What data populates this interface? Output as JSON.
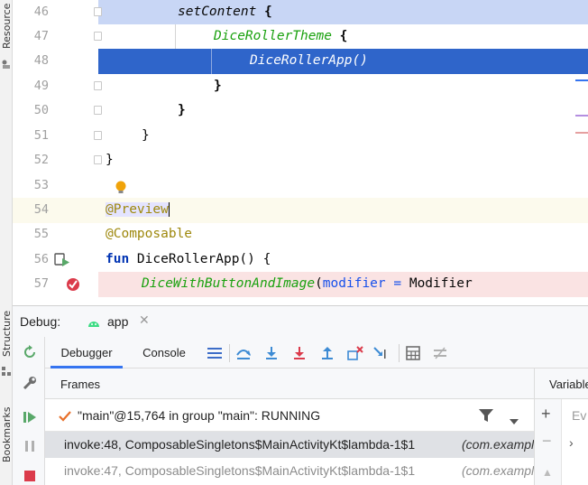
{
  "left_strip": {
    "resource_label": "Resource",
    "structure_label": "Structure",
    "bookmarks_label": "Bookmarks"
  },
  "editor": {
    "lines": [
      {
        "num": "46"
      },
      {
        "num": "47"
      },
      {
        "num": "48"
      },
      {
        "num": "49"
      },
      {
        "num": "50"
      },
      {
        "num": "51"
      },
      {
        "num": "52"
      },
      {
        "num": "53"
      },
      {
        "num": "54"
      },
      {
        "num": "55"
      },
      {
        "num": "56"
      },
      {
        "num": "57"
      }
    ],
    "code": {
      "l46": "setContent",
      "l46_brace": " {",
      "l47": "DiceRollerTheme",
      "l47_brace": " {",
      "l48": "DiceRollerApp()",
      "l49": "}",
      "l50": "}",
      "l51": "}",
      "l52": "}",
      "l54": "@Preview",
      "l55": "@Composable",
      "l56_kw": "fun",
      "l56_rest": " DiceRollerApp() {",
      "l57_fn": "DiceWithButtonAndImage",
      "l57_paren": "(",
      "l57_param": "modifier",
      "l57_eq": " = ",
      "l57_val": "Modifier"
    }
  },
  "debug": {
    "title": "Debug:",
    "session_tab": "app",
    "tabs": [
      "Debugger",
      "Console"
    ],
    "frames_label": "Frames",
    "variables_label": "Variable",
    "thread": "\"main\"@15,764 in group \"main\": RUNNING",
    "frames": [
      {
        "text": "invoke:48, ComposableSingletons$MainActivityKt$lambda-1$1",
        "pkg": "(com.example"
      },
      {
        "text": "invoke:47, ComposableSingletons$MainActivityKt$lambda-1$1",
        "pkg": "(com.example"
      }
    ],
    "eval_placeholder": "Ev"
  },
  "colors": {
    "current_line": "#2f65ca",
    "breakpoint_line": "#fae3e3",
    "selection_block": "#c8d6f5",
    "accent_blue": "#3574f0"
  }
}
